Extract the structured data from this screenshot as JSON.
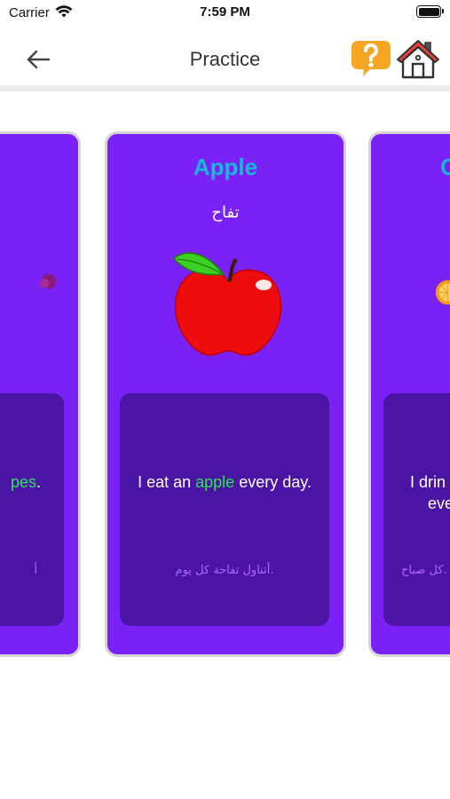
{
  "status_bar": {
    "carrier": "Carrier",
    "time": "7:59 PM"
  },
  "nav": {
    "title": "Practice",
    "back_icon": "arrow-left-icon",
    "help_icon": "question-bubble-icon",
    "home_icon": "house-icon"
  },
  "colors": {
    "card_bg": "#7a22f5",
    "sentence_box_bg": "#4a14a4",
    "title_color": "#19b8da",
    "highlight_color": "#2ee05a",
    "arabic_sentence_color": "#b266ff",
    "help_icon_color": "#f5a623",
    "home_roof_color": "#e8423a"
  },
  "cards": {
    "left": {
      "image_icon": "grapes-icon",
      "sentence_highlight": "pes",
      "sentence_after": ".",
      "sentence_ar": "أ"
    },
    "center": {
      "title": "Apple",
      "translation": "تفاح",
      "image_icon": "apple-icon",
      "sentence_before": "I eat an ",
      "sentence_highlight": "apple",
      "sentence_after": " every day.",
      "sentence_ar": "أتناول تفاحة كل يوم."
    },
    "right": {
      "title": "O",
      "image_icon": "orange-icon",
      "sentence_line1": "I drin",
      "sentence_line2": "eve",
      "sentence_ar": "كل صباح."
    }
  }
}
